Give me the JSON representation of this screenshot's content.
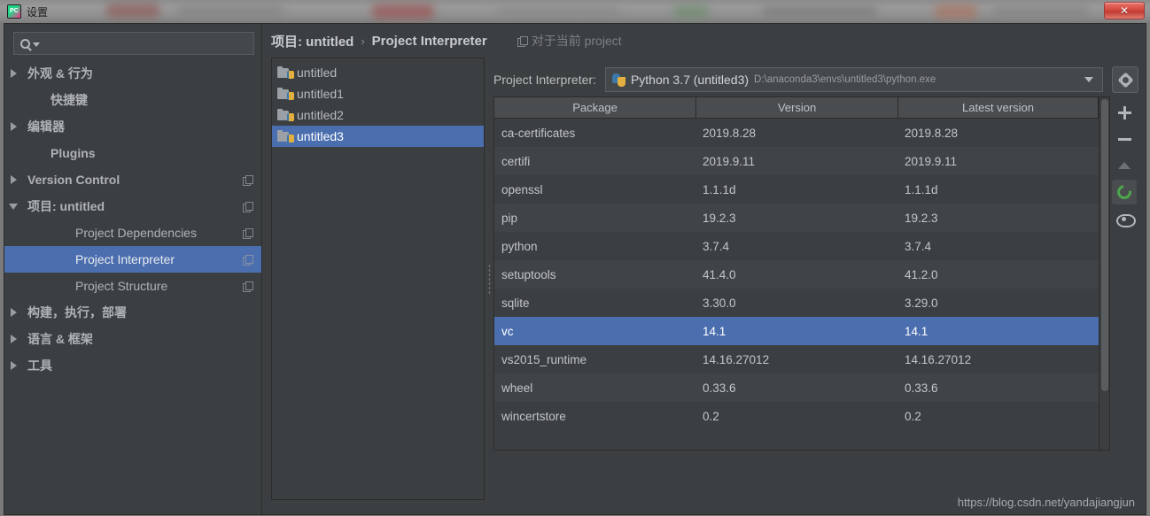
{
  "window": {
    "app_icon": "pycharm-logo-icon",
    "title": "设置",
    "close_label": "✕"
  },
  "sidebar": {
    "search": {
      "placeholder": "",
      "value": "",
      "icon": "search-icon"
    },
    "items": [
      {
        "label": "外观 & 行为",
        "arrow": "right",
        "level": 0,
        "bold": true,
        "copy": false,
        "selected": false
      },
      {
        "label": "快捷键",
        "arrow": "none",
        "level": 0,
        "bold": true,
        "copy": false,
        "selected": false
      },
      {
        "label": "编辑器",
        "arrow": "right",
        "level": 0,
        "bold": true,
        "copy": false,
        "selected": false
      },
      {
        "label": "Plugins",
        "arrow": "none",
        "level": 0,
        "bold": true,
        "copy": false,
        "selected": false
      },
      {
        "label": "Version Control",
        "arrow": "right",
        "level": 0,
        "bold": true,
        "copy": true,
        "selected": false
      },
      {
        "label": "项目: untitled",
        "arrow": "down",
        "level": 0,
        "bold": true,
        "copy": true,
        "selected": false
      },
      {
        "label": "Project Dependencies",
        "arrow": "none",
        "level": 1,
        "bold": false,
        "copy": true,
        "selected": false
      },
      {
        "label": "Project Interpreter",
        "arrow": "none",
        "level": 1,
        "bold": false,
        "copy": true,
        "selected": true
      },
      {
        "label": "Project Structure",
        "arrow": "none",
        "level": 1,
        "bold": false,
        "copy": true,
        "selected": false
      },
      {
        "label": "构建，执行，部署",
        "arrow": "right",
        "level": 0,
        "bold": true,
        "copy": false,
        "selected": false
      },
      {
        "label": "语言 & 框架",
        "arrow": "right",
        "level": 0,
        "bold": true,
        "copy": false,
        "selected": false
      },
      {
        "label": "工具",
        "arrow": "right",
        "level": 0,
        "bold": true,
        "copy": false,
        "selected": false
      }
    ]
  },
  "breadcrumb": {
    "root": "项目: untitled",
    "separator": "›",
    "current": "Project Interpreter",
    "scope_icon": "copy-icon",
    "scope_text": "对于当前 project"
  },
  "project_list": {
    "items": [
      {
        "name": "untitled",
        "selected": false
      },
      {
        "name": "untitled1",
        "selected": false
      },
      {
        "name": "untitled2",
        "selected": false
      },
      {
        "name": "untitled3",
        "selected": true
      }
    ]
  },
  "interpreter": {
    "label": "Project Interpreter:",
    "icon": "python-icon",
    "name": "Python 3.7 (untitled3)",
    "path": "D:\\anaconda3\\envs\\untitled3\\python.exe",
    "caret_icon": "chevron-down-icon",
    "settings_icon": "gear-icon"
  },
  "packages": {
    "columns": [
      "Package",
      "Version",
      "Latest version"
    ],
    "rows": [
      {
        "package": "ca-certificates",
        "version": "2019.8.28",
        "latest": "2019.8.28",
        "selected": false
      },
      {
        "package": "certifi",
        "version": "2019.9.11",
        "latest": "2019.9.11",
        "selected": false
      },
      {
        "package": "openssl",
        "version": "1.1.1d",
        "latest": "1.1.1d",
        "selected": false
      },
      {
        "package": "pip",
        "version": "19.2.3",
        "latest": "19.2.3",
        "selected": false
      },
      {
        "package": "python",
        "version": "3.7.4",
        "latest": "3.7.4",
        "selected": false
      },
      {
        "package": "setuptools",
        "version": "41.4.0",
        "latest": "41.2.0",
        "selected": false
      },
      {
        "package": "sqlite",
        "version": "3.30.0",
        "latest": "3.29.0",
        "selected": false
      },
      {
        "package": "vc",
        "version": "14.1",
        "latest": "14.1",
        "selected": true
      },
      {
        "package": "vs2015_runtime",
        "version": "14.16.27012",
        "latest": "14.16.27012",
        "selected": false
      },
      {
        "package": "wheel",
        "version": "0.33.6",
        "latest": "0.33.6",
        "selected": false
      },
      {
        "package": "wincertstore",
        "version": "0.2",
        "latest": "0.2",
        "selected": false
      }
    ]
  },
  "toolbar": {
    "buttons": [
      {
        "name": "add-package-button",
        "icon": "plus-icon",
        "active": false
      },
      {
        "name": "remove-package-button",
        "icon": "minus-icon",
        "active": false
      },
      {
        "name": "upgrade-package-button",
        "icon": "arrow-up-icon",
        "active": false
      },
      {
        "name": "refresh-button",
        "icon": "refresh-icon",
        "active": true
      },
      {
        "name": "show-early-releases-button",
        "icon": "eye-icon",
        "active": false
      }
    ]
  },
  "watermark": {
    "text": "https://blog.csdn.net/yandajiangjun"
  },
  "colors": {
    "panel_bg": "#3c3f41",
    "selection_blue": "#4b6eaf",
    "row_alt": "#414447",
    "header_bg": "#4a4d4f",
    "text": "#c3c6c9",
    "muted_text": "#9a9da0",
    "refresh_green": "#4ca64c",
    "close_red": "#d44b41"
  }
}
